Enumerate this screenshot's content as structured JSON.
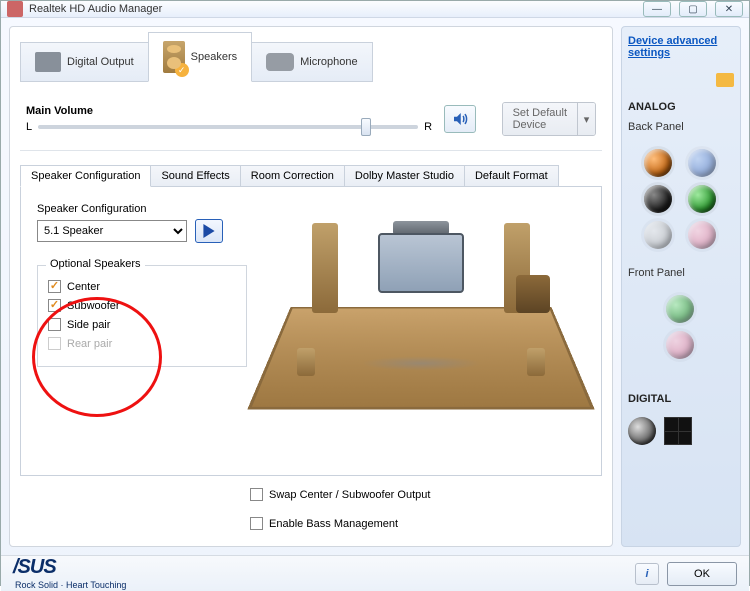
{
  "title": "Realtek HD Audio Manager",
  "win_controls": {
    "min": "—",
    "max": "▢",
    "close": "✕"
  },
  "device_tabs": {
    "digital": "Digital Output",
    "speakers": "Speakers",
    "microphone": "Microphone"
  },
  "main_volume": {
    "label": "Main Volume",
    "left": "L",
    "right": "R",
    "thumb_percent": 85
  },
  "set_default": {
    "label": "Set Default\nDevice"
  },
  "sub_tabs": {
    "speaker_config": "Speaker Configuration",
    "sound_effects": "Sound Effects",
    "room_correction": "Room Correction",
    "dolby": "Dolby Master Studio",
    "default_format": "Default Format"
  },
  "speaker_config": {
    "label": "Speaker Configuration",
    "selected": "5.1 Speaker"
  },
  "optional": {
    "legend": "Optional Speakers",
    "center": {
      "label": "Center",
      "checked": true
    },
    "subwoofer": {
      "label": "Subwoofer",
      "checked": true
    },
    "side_pair": {
      "label": "Side pair",
      "checked": false
    },
    "rear_pair": {
      "label": "Rear pair",
      "checked": false,
      "disabled": true
    }
  },
  "room_checks": {
    "swap": {
      "label": "Swap Center / Subwoofer Output",
      "checked": false
    },
    "bass": {
      "label": "Enable Bass Management",
      "checked": false
    }
  },
  "right": {
    "link": "Device advanced settings",
    "analog": "ANALOG",
    "back_panel": "Back Panel",
    "front_panel": "Front Panel",
    "digital": "DIGITAL"
  },
  "footer": {
    "brand": "/SUS",
    "tagline": "Rock Solid · Heart Touching",
    "ok": "OK"
  }
}
